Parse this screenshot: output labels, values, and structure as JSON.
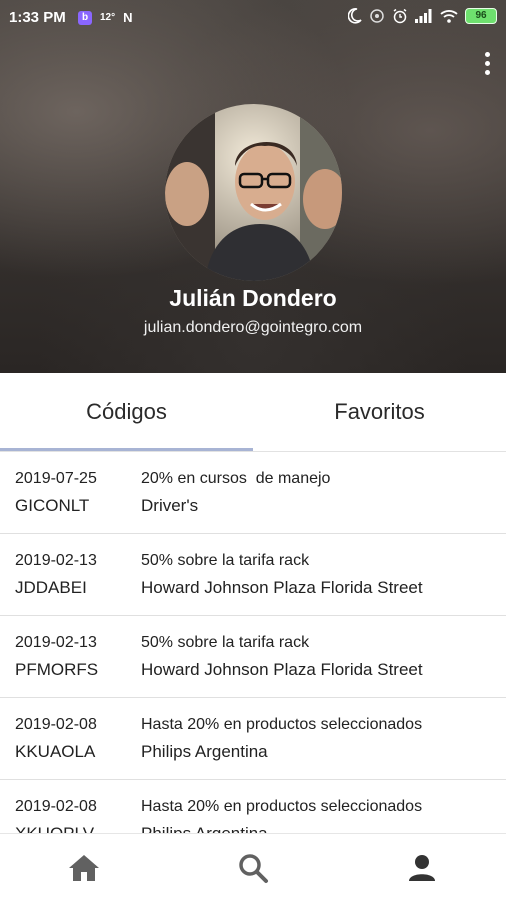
{
  "status_bar": {
    "time": "1:33 PM",
    "temperature": "12°",
    "battery": "96",
    "icons": [
      "app-notification-icon",
      "weather-icon",
      "n-icon",
      "moon-icon",
      "hotspot-icon",
      "alarm-icon",
      "signal-icon",
      "wifi-icon",
      "battery-icon"
    ]
  },
  "profile": {
    "name": "Julián Dondero",
    "email": "julian.dondero@gointegro.com"
  },
  "tabs": [
    {
      "label": "Códigos",
      "active": true
    },
    {
      "label": "Favoritos",
      "active": false
    }
  ],
  "codes": [
    {
      "date": "2019-07-25",
      "code": "GICONLT",
      "description": "20% en cursos  de manejo",
      "store": "Driver's"
    },
    {
      "date": "2019-02-13",
      "code": "JDDABEI",
      "description": "50% sobre la tarifa rack",
      "store": "Howard Johnson Plaza Florida Street"
    },
    {
      "date": "2019-02-13",
      "code": "PFMORFS",
      "description": "50% sobre la tarifa rack",
      "store": "Howard Johnson Plaza Florida Street"
    },
    {
      "date": "2019-02-08",
      "code": "KKUAOLA",
      "description": "Hasta 20% en productos seleccionados",
      "store": "Philips Argentina"
    },
    {
      "date": "2019-02-08",
      "code": "XKUQPLV",
      "description": "Hasta 20% en productos seleccionados",
      "store": "Philips Argentina"
    }
  ],
  "bottom_nav": [
    "home-icon",
    "search-icon",
    "profile-icon"
  ],
  "colors": {
    "tab_indicator": "#a8b4d4",
    "battery": "#6ee06e"
  }
}
